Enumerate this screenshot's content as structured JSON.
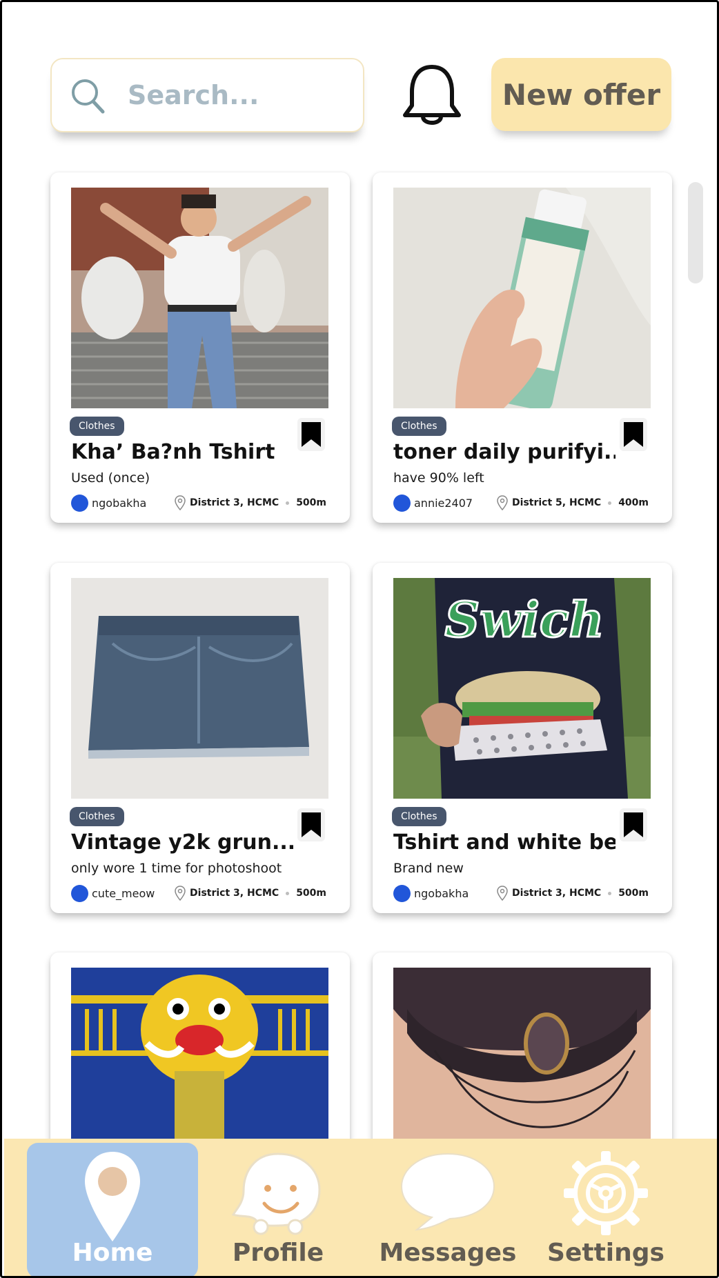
{
  "header": {
    "search_placeholder": "Search...",
    "new_offer_label": "New offer"
  },
  "listings": [
    {
      "category": "Clothes",
      "title": "Kha’ Ba?nh Tshirt",
      "description": "Used (once)",
      "owner": "ngobakha",
      "location": "District 3, HCMC",
      "distance": "500m"
    },
    {
      "category": "Clothes",
      "title": "toner daily purifyi...",
      "description": "have 90% left",
      "owner": "annie2407",
      "location": "District 5, HCMC",
      "distance": "400m"
    },
    {
      "category": "Clothes",
      "title": "Vintage y2k grun...",
      "description": "only wore 1 time for photoshoot",
      "owner": "cute_meow",
      "location": "District 3, HCMC",
      "distance": "500m"
    },
    {
      "category": "Clothes",
      "title": "Tshirt and white bell",
      "description": "Brand new",
      "owner": "ngobakha",
      "location": "District 3, HCMC",
      "distance": "500m"
    }
  ],
  "nav": {
    "items": [
      {
        "label": "Home",
        "icon": "map-pin-icon",
        "active": true
      },
      {
        "label": "Profile",
        "icon": "smiley-ghost-icon",
        "active": false
      },
      {
        "label": "Messages",
        "icon": "speech-bubble-icon",
        "active": false
      },
      {
        "label": "Settings",
        "icon": "gear-icon",
        "active": false
      }
    ]
  },
  "colors": {
    "accent_yellow": "#fbe6ad",
    "active_tab": "#a7c6e9",
    "badge": "#48566d",
    "avatar": "#2156d9"
  }
}
